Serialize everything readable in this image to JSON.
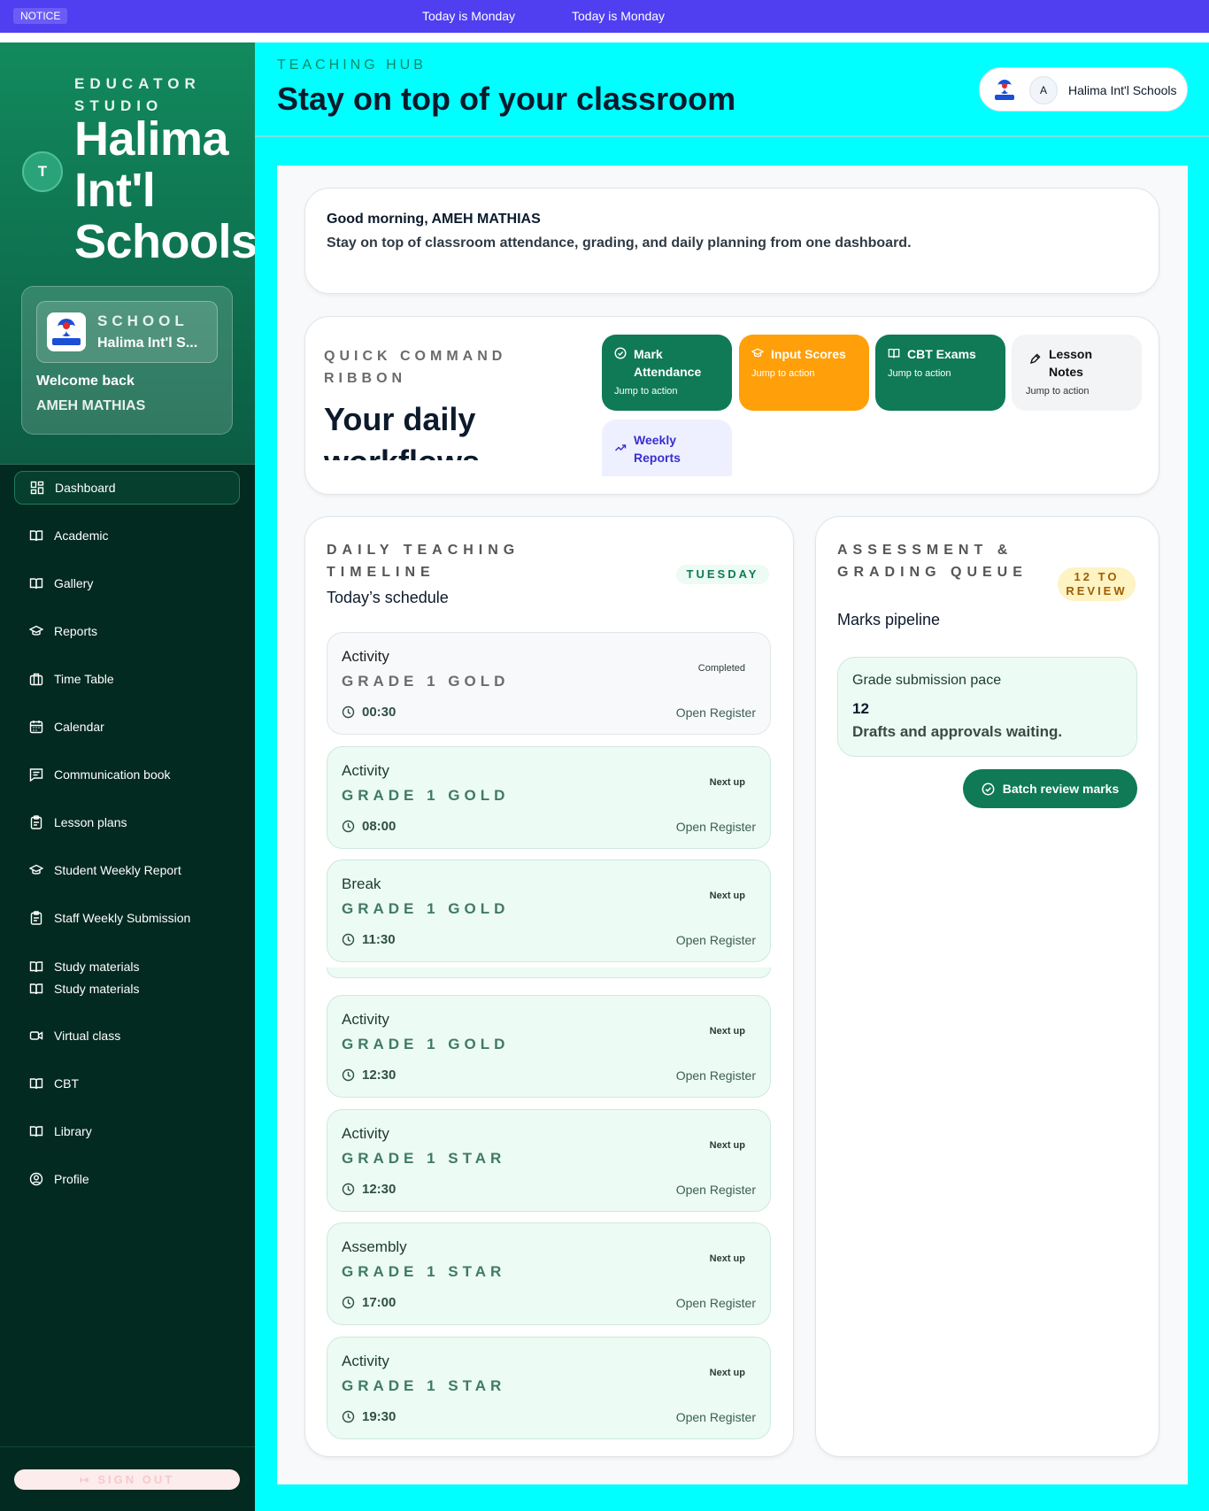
{
  "notice": {
    "tag": "NOTICE",
    "messages": [
      "Today is Monday",
      "Today is Monday"
    ]
  },
  "sidebar": {
    "avatar_initial": "T",
    "studio_label": "EDUCATOR STUDIO",
    "brand": "Halima Int'l Schools",
    "school_label": "SCHOOL",
    "school_name": "Halima Int'l S...",
    "welcome": "Welcome back",
    "user_name": "AMEH MATHIAS",
    "items": [
      {
        "label": "Dashboard",
        "icon": "grid-icon"
      },
      {
        "label": "Academic",
        "icon": "book-icon"
      },
      {
        "label": "Gallery",
        "icon": "book-icon"
      },
      {
        "label": "Reports",
        "icon": "graduation-cap-icon"
      },
      {
        "label": "Time Table",
        "icon": "briefcase-icon"
      },
      {
        "label": "Calendar",
        "icon": "calendar-icon"
      },
      {
        "label": "Communication book",
        "icon": "message-icon"
      },
      {
        "label": "Lesson plans",
        "icon": "clipboard-icon"
      },
      {
        "label": "Student Weekly Report",
        "icon": "graduation-cap-icon"
      },
      {
        "label": "Staff Weekly Submission",
        "icon": "clipboard-icon"
      },
      {
        "label": "Study materials",
        "icon": "book-icon"
      },
      {
        "label": "Study materials",
        "icon": "book-icon"
      },
      {
        "label": "Virtual class",
        "icon": "video-icon"
      },
      {
        "label": "CBT",
        "icon": "book-icon"
      },
      {
        "label": "Library",
        "icon": "book-icon"
      },
      {
        "label": "Profile",
        "icon": "user-circle-icon"
      }
    ],
    "sign_out": "SIGN OUT"
  },
  "header": {
    "label": "TEACHING HUB",
    "title": "Stay on top of your classroom",
    "user_initial": "A",
    "school_name": "Halima Int'l Schools"
  },
  "greeting": {
    "title": "Good morning, AMEH MATHIAS",
    "body": "Stay on top of classroom attendance, grading, and daily planning from one dashboard."
  },
  "ribbon": {
    "label": "QUICK COMMAND RIBBON",
    "title": "Your daily workflows",
    "actions": [
      {
        "title": "Mark Attendance",
        "sub": "Jump to action",
        "icon": "check-circle-icon",
        "color": "#0f7a55"
      },
      {
        "title": "Input Scores",
        "sub": "Jump to action",
        "icon": "graduation-cap-icon",
        "color": "#ff9f0a"
      },
      {
        "title": "CBT Exams",
        "sub": "Jump to action",
        "icon": "book-icon",
        "color": "#0f7a55"
      },
      {
        "title": "Lesson Notes",
        "sub": "Jump to action",
        "icon": "pen-icon",
        "color": "#f2f4f5"
      },
      {
        "title": "Weekly Reports",
        "sub": "",
        "icon": "trending-up-icon",
        "color": "#eef0ff"
      }
    ]
  },
  "timeline": {
    "label": "DAILY TEACHING TIMELINE",
    "title": "Today’s schedule",
    "day": "TUESDAY",
    "items": [
      {
        "activity": "Activity",
        "grade": "GRADE 1 GOLD",
        "time": "00:30",
        "status": "Completed",
        "action": "Open Register"
      },
      {
        "activity": "Activity",
        "grade": "GRADE 1 GOLD",
        "time": "08:00",
        "status": "Next up",
        "action": "Open Register"
      },
      {
        "activity": "Break",
        "grade": "GRADE 1 GOLD",
        "time": "11:30",
        "status": "Next up",
        "action": "Open Register"
      },
      {
        "activity": "Activity",
        "grade": "GRADE 1 GOLD",
        "time": "12:30",
        "status": "Next up",
        "action": "Open Register"
      },
      {
        "activity": "Activity",
        "grade": "GRADE 1 STAR",
        "time": "12:30",
        "status": "Next up",
        "action": "Open Register"
      },
      {
        "activity": "Assembly",
        "grade": "GRADE 1 STAR",
        "time": "17:00",
        "status": "Next up",
        "action": "Open Register"
      },
      {
        "activity": "Activity",
        "grade": "GRADE 1 STAR",
        "time": "19:30",
        "status": "Next up",
        "action": "Open Register"
      }
    ]
  },
  "assessment": {
    "label": "ASSESSMENT & GRADING QUEUE",
    "title": "Marks pipeline",
    "badge": "12 TO REVIEW",
    "pace_label": "Grade submission pace",
    "pace_count": "12",
    "pace_text": "Drafts and approvals waiting.",
    "button": "Batch review marks"
  }
}
